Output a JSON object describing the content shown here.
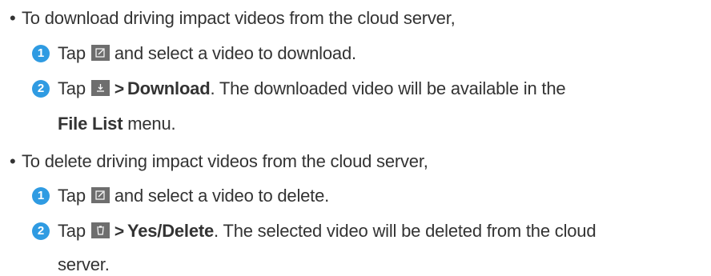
{
  "section1": {
    "intro": "To download driving impact videos from the cloud server,",
    "step1": {
      "number": "1",
      "before": "Tap",
      "after": "and select a video to download."
    },
    "step2": {
      "number": "2",
      "before": "Tap",
      "arrow": ">",
      "bold": "Download",
      "after": ". The downloaded video will be available in the",
      "cont_bold": "File List",
      "cont_after": "menu."
    }
  },
  "section2": {
    "intro": "To delete driving impact videos from the cloud server,",
    "step1": {
      "number": "1",
      "before": "Tap",
      "after": "and select a video to delete."
    },
    "step2": {
      "number": "2",
      "before": "Tap",
      "arrow": ">",
      "bold": "Yes/Delete",
      "after": ". The selected video will be deleted from the cloud",
      "cont_after": "server."
    }
  },
  "bullet_char": "•",
  "colors": {
    "step_circle": "#2f9be2",
    "icon_bg": "#6e6e6e",
    "text": "#333333"
  },
  "icons": [
    "edit-icon",
    "download-icon",
    "trash-icon"
  ]
}
